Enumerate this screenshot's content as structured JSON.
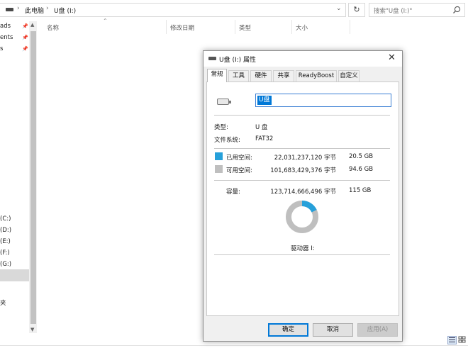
{
  "address_bar": {
    "breadcrumbs": [
      "此电脑",
      "U盘 (I:)"
    ],
    "separator": "›",
    "dropdown": "⌄",
    "refresh": "↻",
    "search_placeholder": "搜索\"U盘 (I:)\""
  },
  "nav": {
    "quick_access": [
      {
        "label": "ads",
        "pinned": true
      },
      {
        "label": "ents",
        "pinned": true
      },
      {
        "label": "s",
        "pinned": true
      }
    ],
    "pin_glyph": "📌",
    "drives": [
      {
        "label": "(C:)"
      },
      {
        "label": "(D:)"
      },
      {
        "label": "(E:)"
      },
      {
        "label": "(F:)"
      },
      {
        "label": "(G:)"
      }
    ],
    "other": "夹"
  },
  "columns": [
    "名称",
    "修改日期",
    "类型",
    "大小"
  ],
  "dialog": {
    "title": "U盘 (I:) 属性",
    "close": "✕",
    "tabs": [
      "常规",
      "工具",
      "硬件",
      "共享",
      "ReadyBoost",
      "自定义"
    ],
    "active_tab": 0,
    "name_value": "U盘",
    "type_label": "类型:",
    "type_value": "U 盘",
    "fs_label": "文件系统:",
    "fs_value": "FAT32",
    "used": {
      "label": "已用空间:",
      "bytes": "22,031,237,120 字节",
      "size": "20.5 GB",
      "color": "#26a0da"
    },
    "free": {
      "label": "可用空间:",
      "bytes": "101,683,429,376 字节",
      "size": "94.6 GB",
      "color": "#bfbfbf"
    },
    "capacity": {
      "label": "容量:",
      "bytes": "123,714,666,496 字节",
      "size": "115 GB"
    },
    "used_fraction": 0.178,
    "drive_label": "驱动器 I:",
    "buttons": {
      "ok": "确定",
      "cancel": "取消",
      "apply": "应用(A)"
    }
  }
}
